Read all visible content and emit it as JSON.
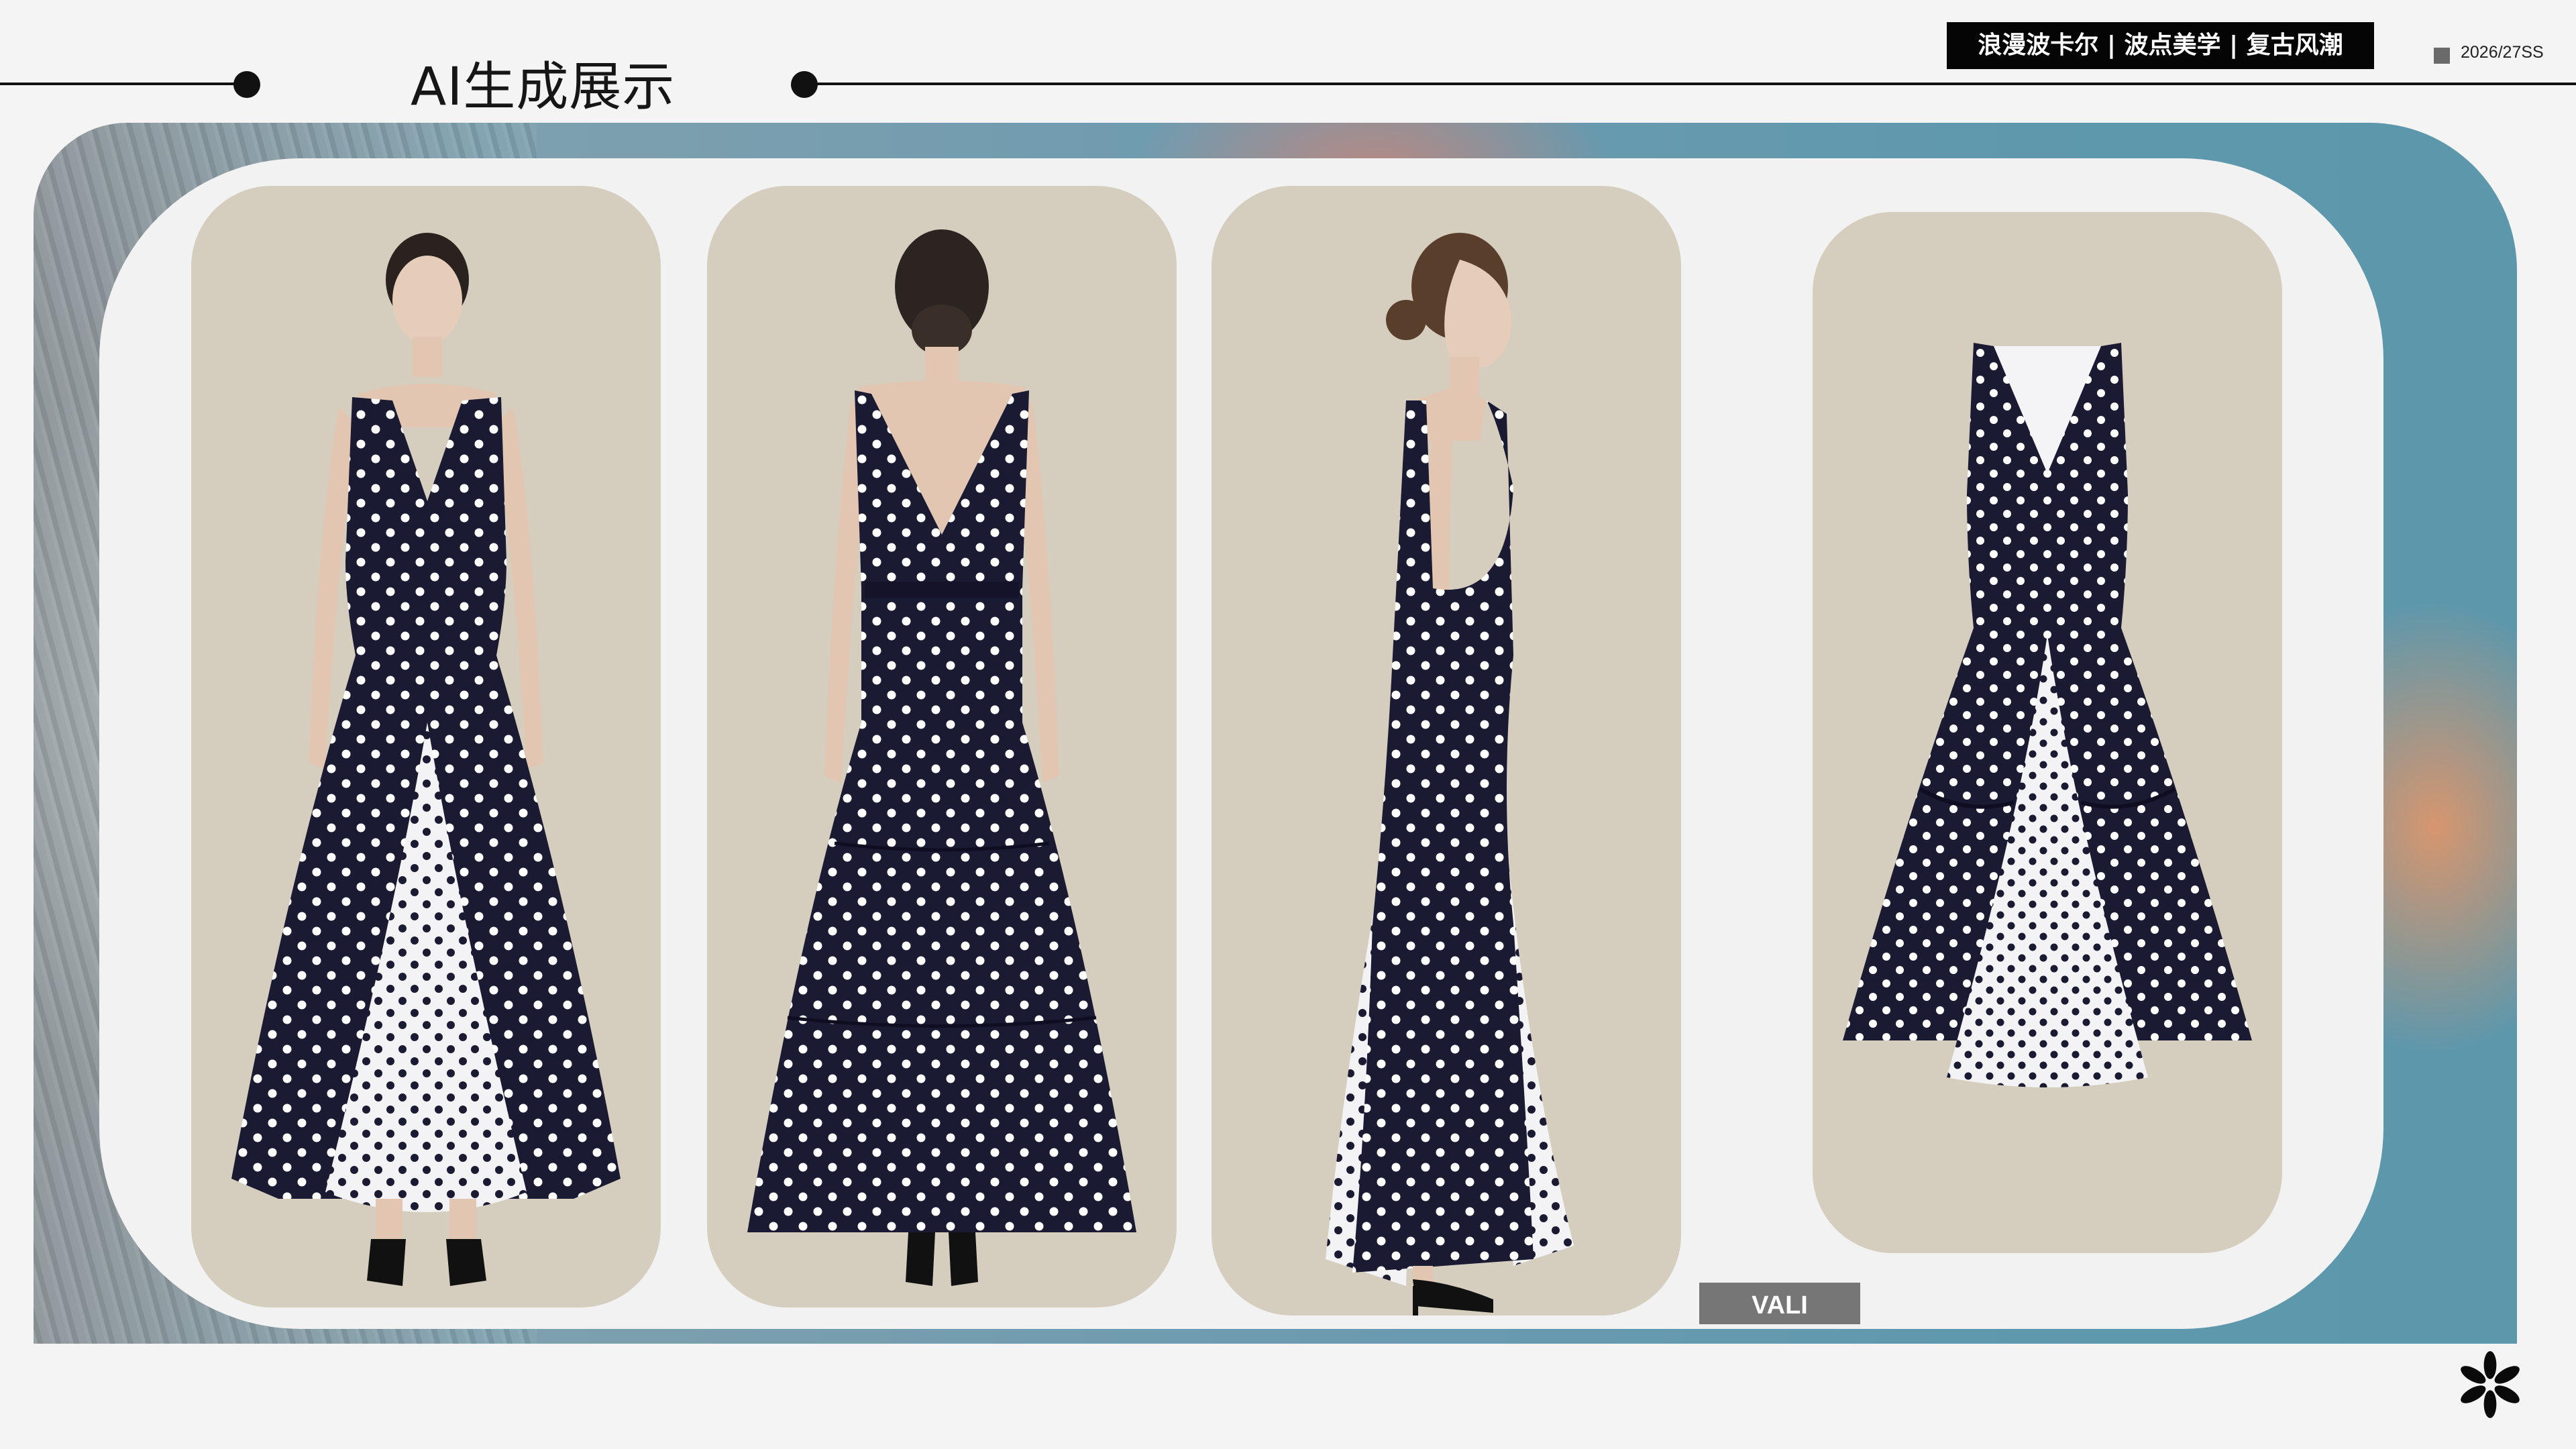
{
  "header": {
    "title": "AI生成展示",
    "tagline": "浪漫波卡尔 | 波点美学 | 复古风潮",
    "season": "2026/27SS"
  },
  "gallery": {
    "cards": [
      {
        "view": "front-model"
      },
      {
        "view": "back-model"
      },
      {
        "view": "side-model"
      },
      {
        "view": "flat-garment"
      }
    ]
  },
  "brand": {
    "label": "VALI"
  },
  "colors": {
    "card_bg": "#d5cebe",
    "dress_navy": "#1b1a33",
    "dot_white": "#ffffff",
    "frame": "#f2f2f2",
    "tag_black": "#050505",
    "brand_tag_gray": "#767676",
    "sky_blue": "#6d9bb0"
  }
}
